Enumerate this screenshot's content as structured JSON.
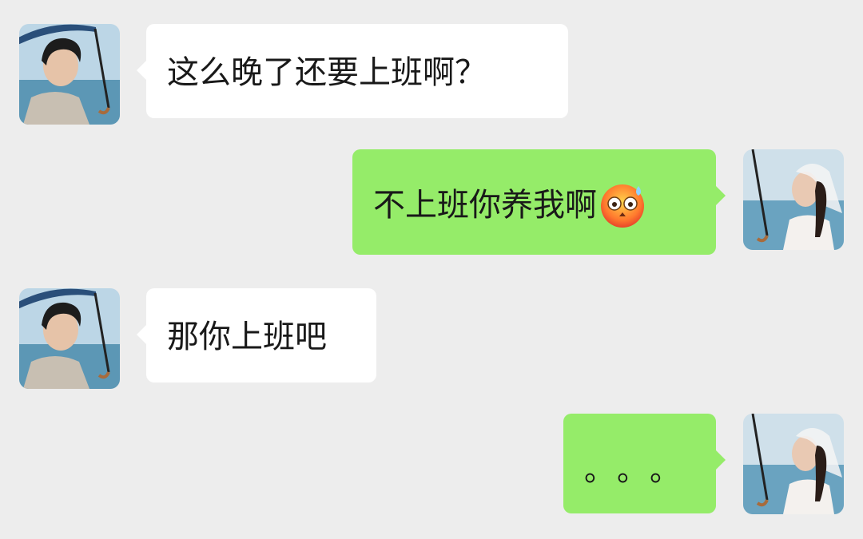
{
  "messages": [
    {
      "side": "left",
      "text": "这么晚了还要上班啊？"
    },
    {
      "side": "right",
      "text": "不上班你养我啊",
      "emoji": "flushed-sweat-face-emoji"
    },
    {
      "side": "left",
      "text": "那你上班吧"
    },
    {
      "side": "right",
      "text": "。。。"
    }
  ],
  "avatars": {
    "left": "man-with-umbrella-avatar",
    "right": "woman-with-umbrella-and-veil-avatar"
  },
  "colors": {
    "background": "#ededed",
    "left_bubble": "#ffffff",
    "right_bubble": "#95ec69",
    "text": "#191919"
  }
}
